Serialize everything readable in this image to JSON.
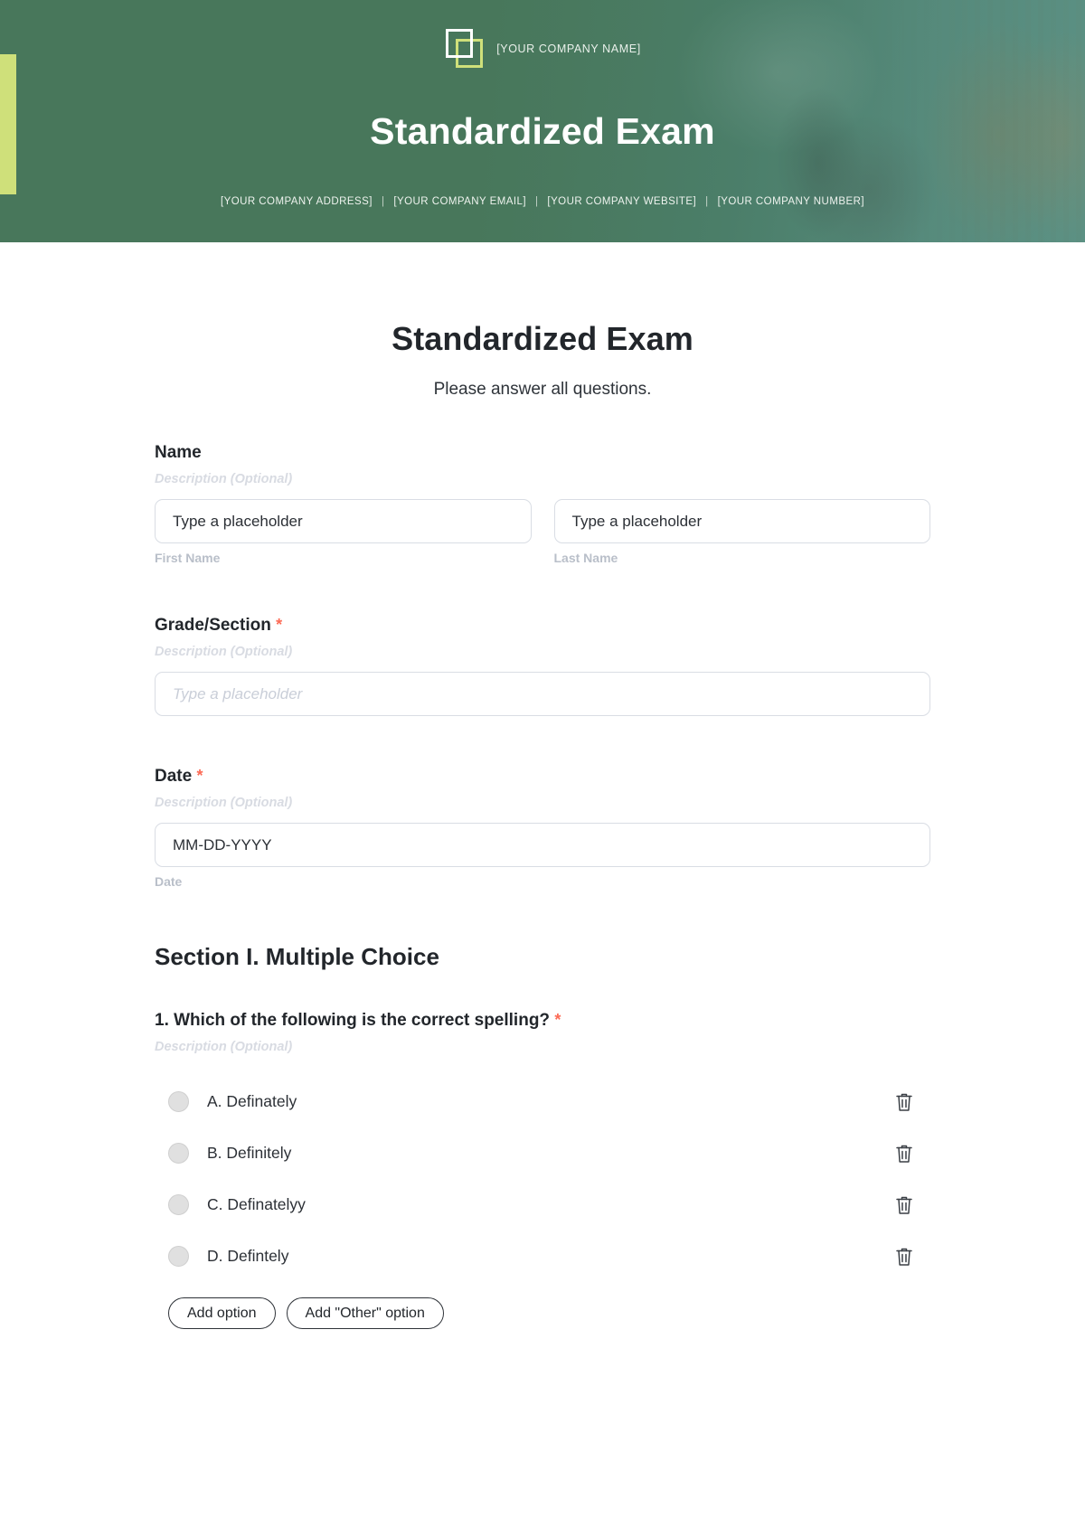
{
  "header": {
    "company_name": "[YOUR COMPANY NAME]",
    "title": "Standardized Exam",
    "contacts": [
      "[YOUR COMPANY ADDRESS]",
      "[YOUR COMPANY EMAIL]",
      "[YOUR COMPANY WEBSITE]",
      "[YOUR COMPANY NUMBER]"
    ],
    "separator": "|",
    "colors": {
      "background_green": "#4b7a5c",
      "accent_green": "#cfe07a",
      "text_white": "#ffffff"
    }
  },
  "form": {
    "title": "Standardized Exam",
    "subtitle": "Please answer all questions.",
    "required_marker": "*",
    "description_placeholder": "Description (Optional)",
    "fields": {
      "name": {
        "label": "Name",
        "description": "Description (Optional)",
        "first": {
          "value": "Type a placeholder",
          "sub_label": "First Name"
        },
        "last": {
          "value": "Type a placeholder",
          "sub_label": "Last Name"
        }
      },
      "grade_section": {
        "label": "Grade/Section",
        "required": true,
        "description": "Description (Optional)",
        "placeholder": "Type a placeholder"
      },
      "date": {
        "label": "Date",
        "required": true,
        "description": "Description (Optional)",
        "value": "MM-DD-YYYY",
        "sub_label": "Date"
      }
    },
    "section_one": {
      "heading": "Section I. Multiple Choice",
      "question": {
        "label": "1. Which of the following is the correct spelling?",
        "required": true,
        "description": "Description (Optional)",
        "options": [
          {
            "text": "A. Definately",
            "delete_icon": "trash-icon"
          },
          {
            "text": "B. Definitely",
            "delete_icon": "trash-icon"
          },
          {
            "text": "C. Definatelyy",
            "delete_icon": "trash-icon"
          },
          {
            "text": "D. Defintely",
            "delete_icon": "trash-icon"
          }
        ],
        "add_option_label": "Add option",
        "add_other_option_label": "Add \"Other\" option"
      }
    },
    "colors": {
      "required_star": "#fc6a55",
      "muted_label": "#b9bfc9",
      "input_border": "#d9dde4"
    }
  }
}
